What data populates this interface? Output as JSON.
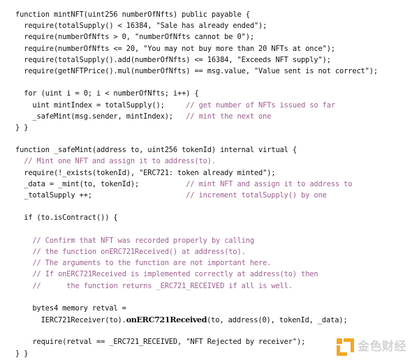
{
  "document": {
    "type": "source-code-screenshot",
    "language": "solidity",
    "background_color": "#ffffff",
    "code_color": "#101010",
    "comment_color": "#9c5e8f",
    "lines": [
      {
        "id": "l1",
        "indent": 0,
        "code": "function mintNFT(uint256 numberOfNfts) public payable {",
        "comment": ""
      },
      {
        "id": "l2",
        "indent": 1,
        "code": "require(totalSupply() < 16384, \"Sale has already ended\");",
        "comment": ""
      },
      {
        "id": "l3",
        "indent": 1,
        "code": "require(numberOfNfts > 0, \"numberOfNfts cannot be 0\");",
        "comment": ""
      },
      {
        "id": "l4",
        "indent": 1,
        "code": "require(numberOfNfts <= 20, \"You may not buy more than 20 NFTs at once\");",
        "comment": ""
      },
      {
        "id": "l5",
        "indent": 1,
        "code": "require(totalSupply().add(numberOfNfts) <= 16384, \"Exceeds NFT supply\");",
        "comment": ""
      },
      {
        "id": "l6",
        "indent": 1,
        "code": "require(getNFTPrice().mul(numberOfNfts) == msg.value, \"Value sent is not correct\");",
        "comment": ""
      },
      {
        "id": "l7",
        "indent": 0,
        "code": "",
        "comment": ""
      },
      {
        "id": "l8",
        "indent": 1,
        "code": "for (uint i = 0; i < numberOfNfts; i++) {",
        "comment": ""
      },
      {
        "id": "l9",
        "indent": 2,
        "code": "uint mintIndex = totalSupply();",
        "comment": "// get number of NFTs issued so far"
      },
      {
        "id": "l10",
        "indent": 2,
        "code": "_safeMint(msg.sender, mintIndex);",
        "comment": "// mint the next one"
      },
      {
        "id": "l11",
        "indent": 0,
        "code": "} }",
        "comment": ""
      },
      {
        "id": "l12",
        "indent": 0,
        "code": "",
        "comment": ""
      },
      {
        "id": "l13",
        "indent": 0,
        "code": "function _safeMint(address to, uint256 tokenId) internal virtual {",
        "comment": ""
      },
      {
        "id": "l14",
        "indent": 1,
        "code": "",
        "comment": "// Mint one NFT and assign it to address(to)."
      },
      {
        "id": "l15",
        "indent": 1,
        "code": "require(!_exists(tokenId), \"ERC721: token already minted\");",
        "comment": ""
      },
      {
        "id": "l16",
        "indent": 1,
        "code": "_data = _mint(to, tokenId);",
        "comment": "// mint NFT and assign it to address to"
      },
      {
        "id": "l17",
        "indent": 1,
        "code": "_totalSupply ++;",
        "comment": "// increment totalSupply() by one"
      },
      {
        "id": "l18",
        "indent": 0,
        "code": "",
        "comment": ""
      },
      {
        "id": "l19",
        "indent": 1,
        "code": "if (to.isContract()) {",
        "comment": ""
      },
      {
        "id": "l20",
        "indent": 0,
        "code": "",
        "comment": ""
      },
      {
        "id": "l21",
        "indent": 2,
        "code": "",
        "comment": "// Confirm that NFT was recorded properly by calling"
      },
      {
        "id": "l22",
        "indent": 2,
        "code": "",
        "comment": "// the function onERC721Received() at address(to)."
      },
      {
        "id": "l23",
        "indent": 2,
        "code": "",
        "comment": "// The arguments to the function are not important here."
      },
      {
        "id": "l24",
        "indent": 2,
        "code": "",
        "comment": "// If onERC721Received is implemented correctly at address(to) then"
      },
      {
        "id": "l25",
        "indent": 2,
        "code": "",
        "comment": "//      the function returns _ERC721_RECEIVED if all is well."
      },
      {
        "id": "l26",
        "indent": 0,
        "code": "",
        "comment": ""
      },
      {
        "id": "l27",
        "indent": 2,
        "code": "bytes4 memory retval =",
        "comment": ""
      },
      {
        "id": "l28",
        "indent": 3,
        "code": "IERC721Receiver(to).onERC721Received(to, address(0), tokenId, _data);",
        "comment": "",
        "emphasis": "onERC721Received"
      },
      {
        "id": "l29",
        "indent": 0,
        "code": "",
        "comment": ""
      },
      {
        "id": "l30",
        "indent": 2,
        "code": "require(retval == _ERC721_RECEIVED, \"NFT Rejected by receiver\");",
        "comment": ""
      },
      {
        "id": "l31",
        "indent": 0,
        "code": "} }",
        "comment": ""
      }
    ]
  },
  "watermark": {
    "text": "金色财经",
    "logo_name": "jinse-finance-logo",
    "logo_color": "#f5a623",
    "text_color": "#d3d3d3"
  }
}
